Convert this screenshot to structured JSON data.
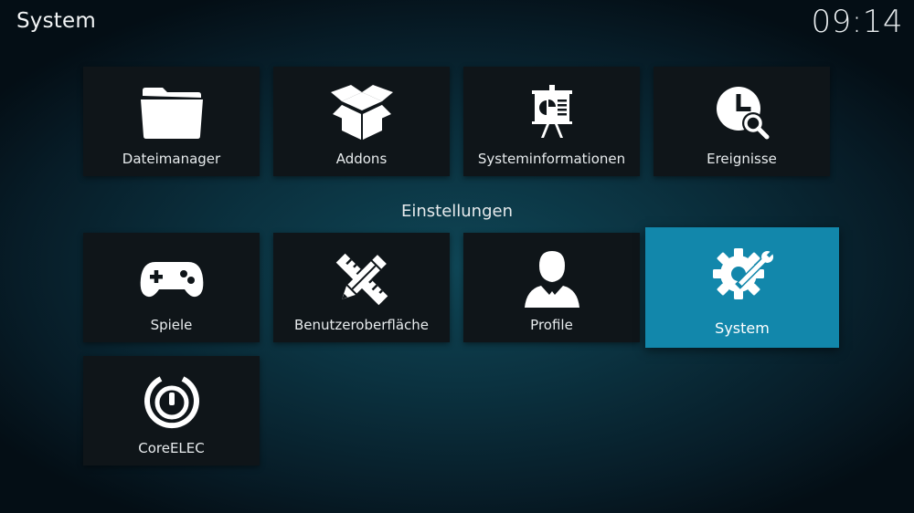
{
  "header": {
    "title": "System",
    "clock": "09:14"
  },
  "section": {
    "title": "Einstellungen"
  },
  "tiles": [
    {
      "label": "Dateimanager",
      "icon": "folder-icon"
    },
    {
      "label": "Addons",
      "icon": "open-box-icon"
    },
    {
      "label": "Systeminformationen",
      "icon": "presentation-board-icon"
    },
    {
      "label": "Ereignisse",
      "icon": "clock-search-icon"
    },
    {
      "label": "Spiele",
      "icon": "gamepad-icon"
    },
    {
      "label": "Benutzeroberfläche",
      "icon": "pencil-ruler-icon"
    },
    {
      "label": "Profile",
      "icon": "user-profile-icon"
    },
    {
      "label": "System",
      "icon": "gear-wrench-icon",
      "focused": true
    },
    {
      "label": "CoreELEC",
      "icon": "power-icon"
    }
  ],
  "colors": {
    "focus": "#1287ab",
    "tile": "#0f1519",
    "text": "#e8ecee"
  }
}
